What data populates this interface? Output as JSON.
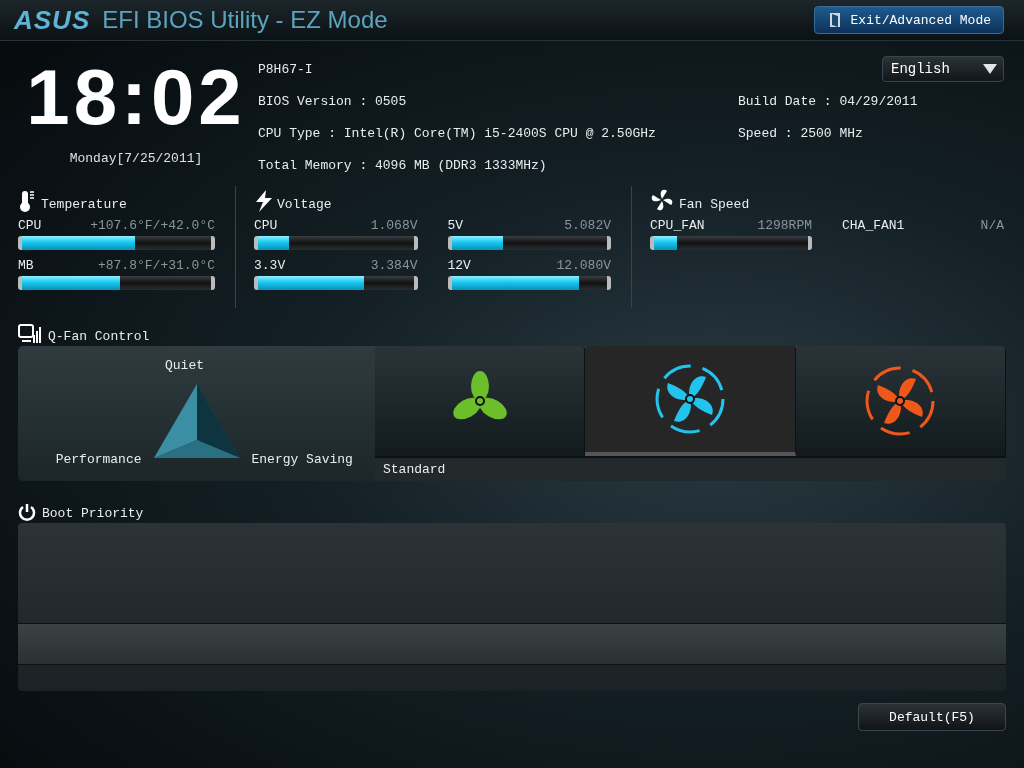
{
  "header": {
    "logo": "ASUS",
    "title": "EFI BIOS Utility - EZ Mode",
    "exit_button": "Exit/Advanced Mode"
  },
  "clock": {
    "time": "18:02",
    "date": "Monday[7/25/2011]"
  },
  "system_info": {
    "left": [
      "P8H67-I",
      "BIOS Version : 0505",
      "CPU Type : Intel(R) Core(TM) i5-2400S CPU @ 2.50GHz",
      "Total Memory : 4096 MB (DDR3 1333MHz)"
    ],
    "right": [
      "Build Date : 04/29/2011",
      "Speed : 2500 MHz"
    ]
  },
  "language": {
    "value": "English"
  },
  "temperature": {
    "title": "Temperature",
    "sensors": [
      {
        "name": "CPU",
        "reading": "+107.6°F/+42.0°C",
        "level": 0.6
      },
      {
        "name": "MB",
        "reading": "+87.8°F/+31.0°C",
        "level": 0.52
      }
    ]
  },
  "voltage": {
    "title": "Voltage",
    "sensors": [
      {
        "name": "CPU",
        "reading": "1.068V",
        "level": 0.2
      },
      {
        "name": "5V",
        "reading": "5.082V",
        "level": 0.33
      },
      {
        "name": "3.3V",
        "reading": "3.384V",
        "level": 0.68
      },
      {
        "name": "12V",
        "reading": "12.080V",
        "level": 0.82
      }
    ]
  },
  "fan_speed": {
    "title": "Fan Speed",
    "fans": [
      {
        "name": "CPU_FAN",
        "reading": "1298RPM",
        "level": 0.15
      },
      {
        "name": "CHA_FAN1",
        "reading": "N/A"
      }
    ]
  },
  "qfan_control": {
    "title": "Q-Fan Control",
    "triangle_labels": {
      "top": "Quiet",
      "left": "Performance",
      "right": "Energy Saving"
    },
    "modes": [
      {
        "selected": false,
        "color": "#6cbf2a"
      },
      {
        "selected": true,
        "color": "#22c4ee"
      },
      {
        "selected": false,
        "color": "#f0581a"
      }
    ],
    "mode_label": "Standard"
  },
  "boot_priority": {
    "title": "Boot Priority"
  },
  "default_button": "Default(F5)"
}
